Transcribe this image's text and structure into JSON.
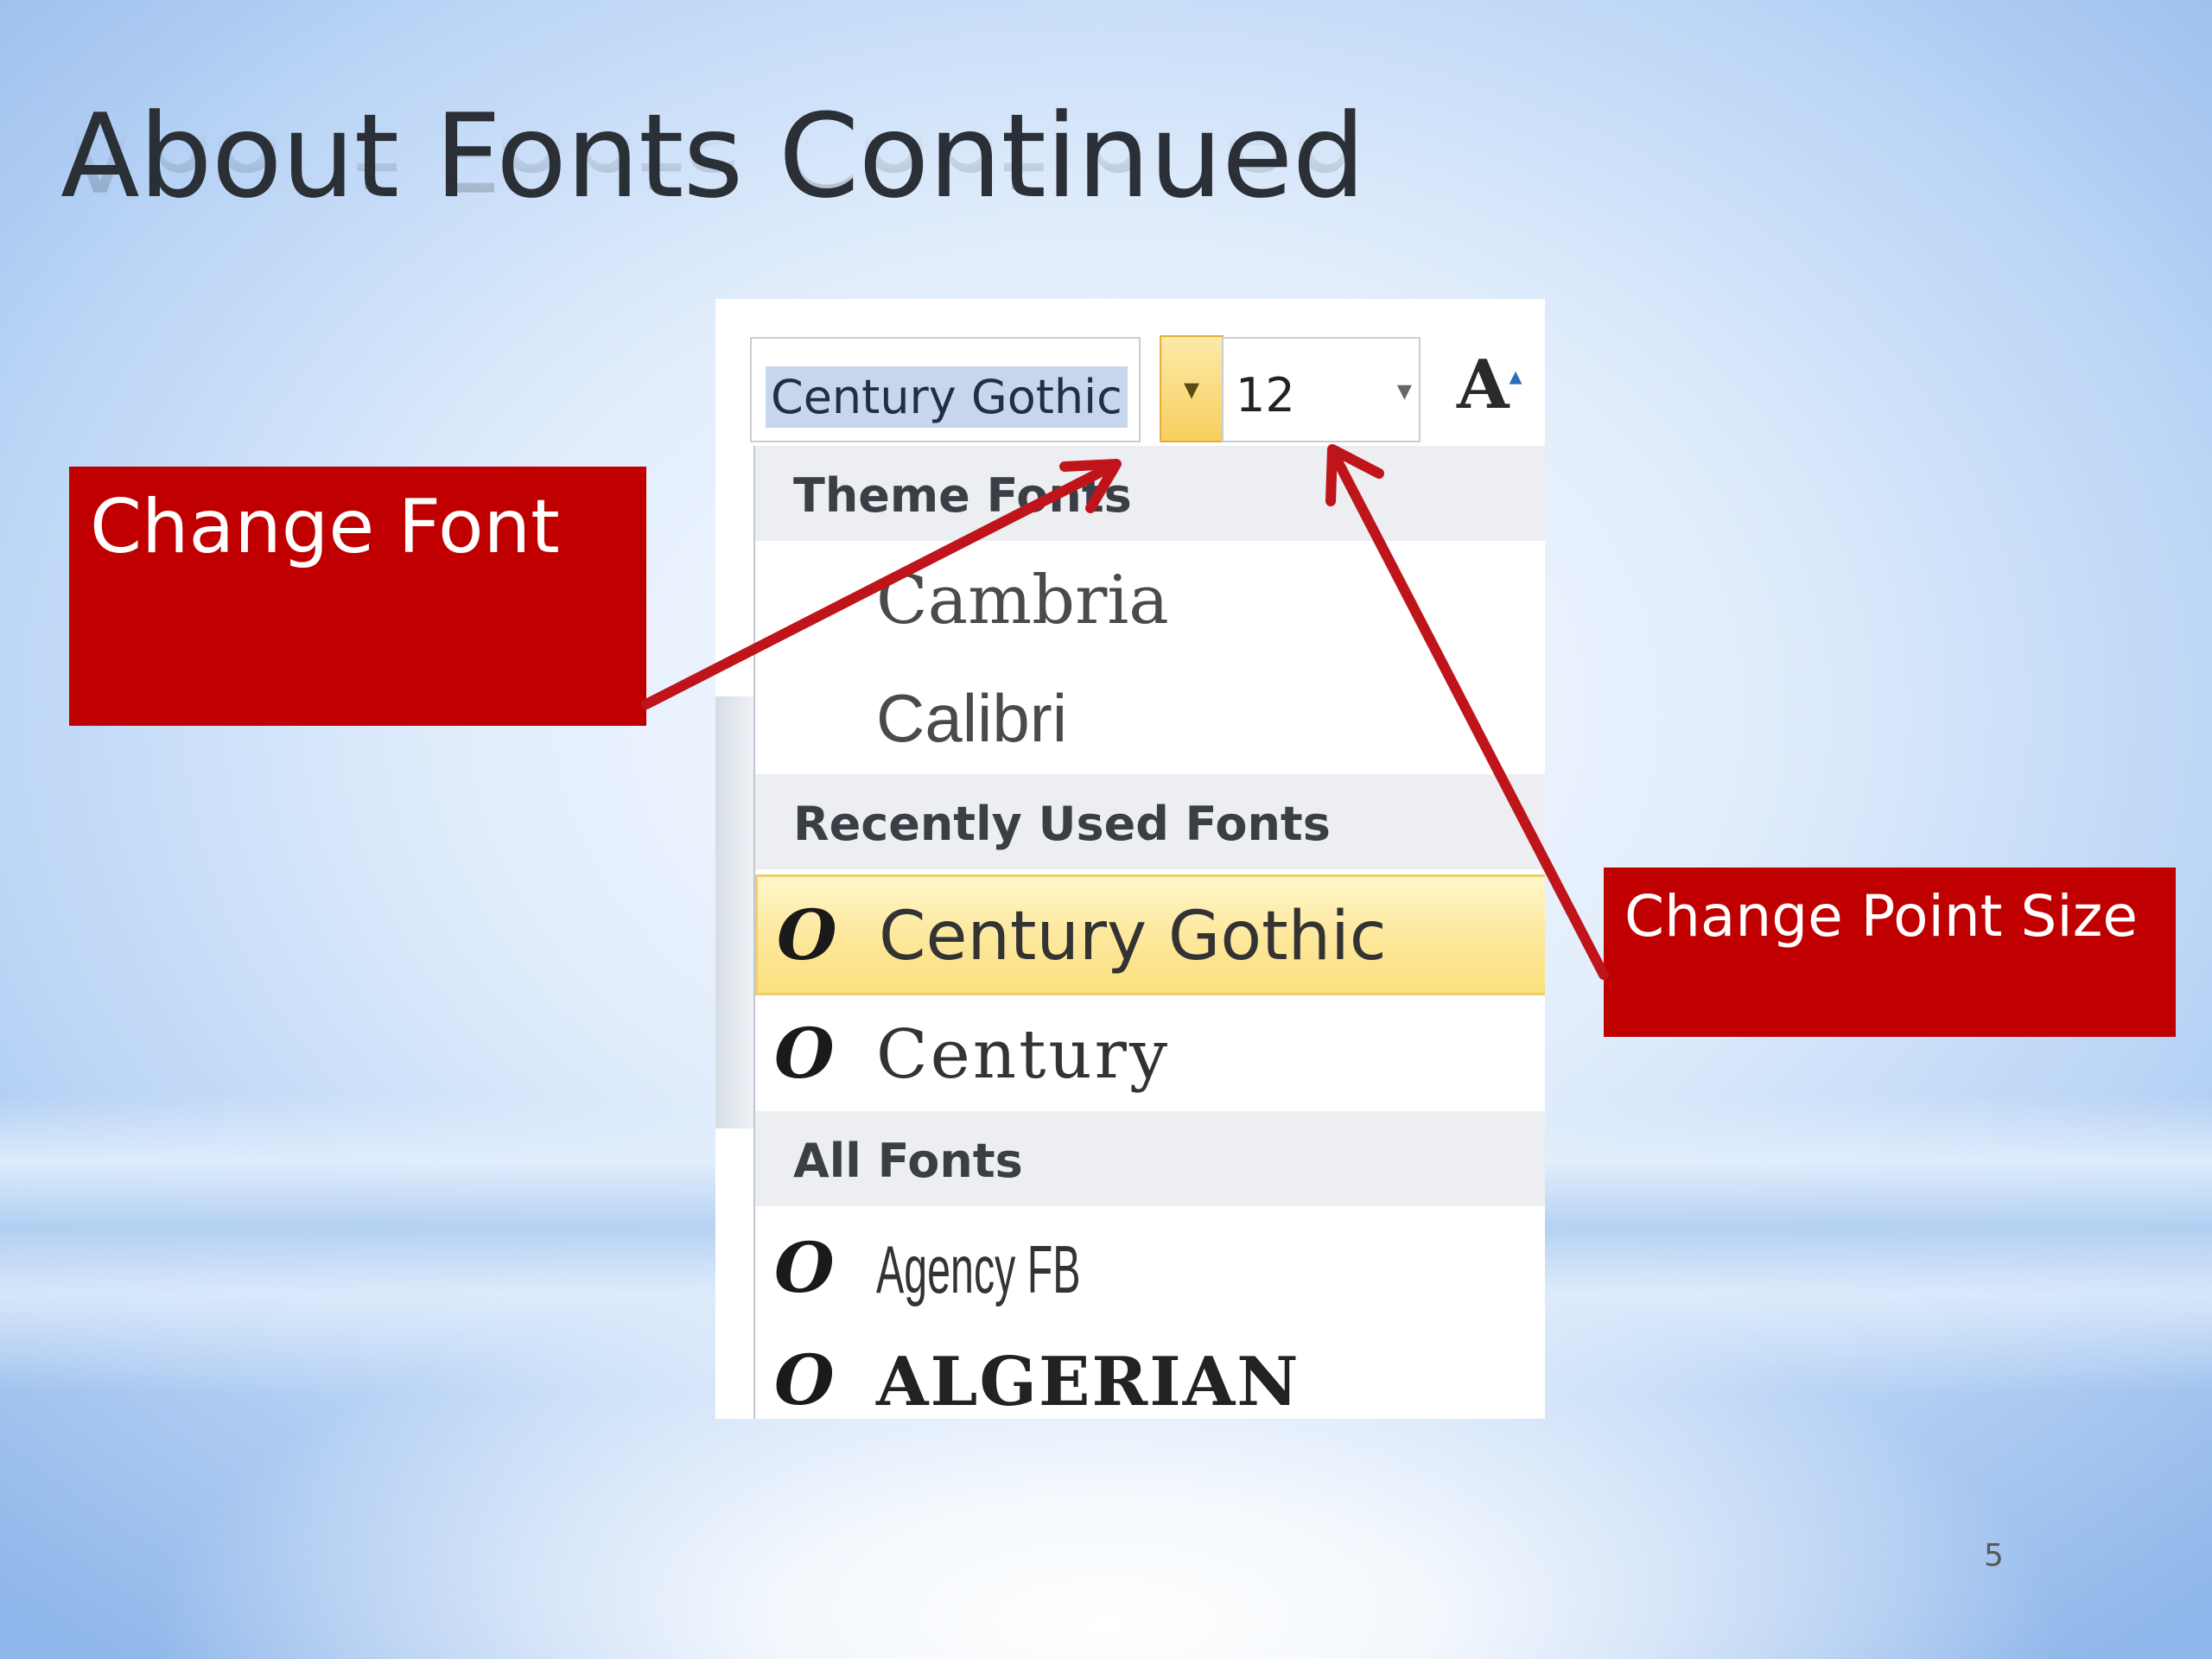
{
  "slide": {
    "title": "About Fonts Continued",
    "page_number": "5"
  },
  "ribbon": {
    "font_box_value": "Century Gothic",
    "font_size_value": "12",
    "dropdown_arrow": "▾",
    "grow_font_icon": "A"
  },
  "font_list": {
    "sections": [
      {
        "header": "Theme Fonts",
        "items": [
          "Cambria",
          "Calibri"
        ]
      },
      {
        "header": "Recently Used Fonts",
        "items": [
          "Century Gothic",
          "Century"
        ]
      },
      {
        "header": "All Fonts",
        "items": [
          "Agency FB",
          "ALGERIAN"
        ]
      }
    ],
    "selected_item": "Century Gothic",
    "otf_icon_glyph": "O"
  },
  "callouts": {
    "change_font": "Change Font",
    "change_point_size": "Change Point Size"
  },
  "colors": {
    "callout_red": "#c00000",
    "arrow_red": "#c0141b",
    "selection_yellow": "#fde79a"
  },
  "icons": {
    "dropdown": "chevron-down-icon",
    "grow_font": "grow-font-icon",
    "opentype": "opentype-font-icon"
  }
}
